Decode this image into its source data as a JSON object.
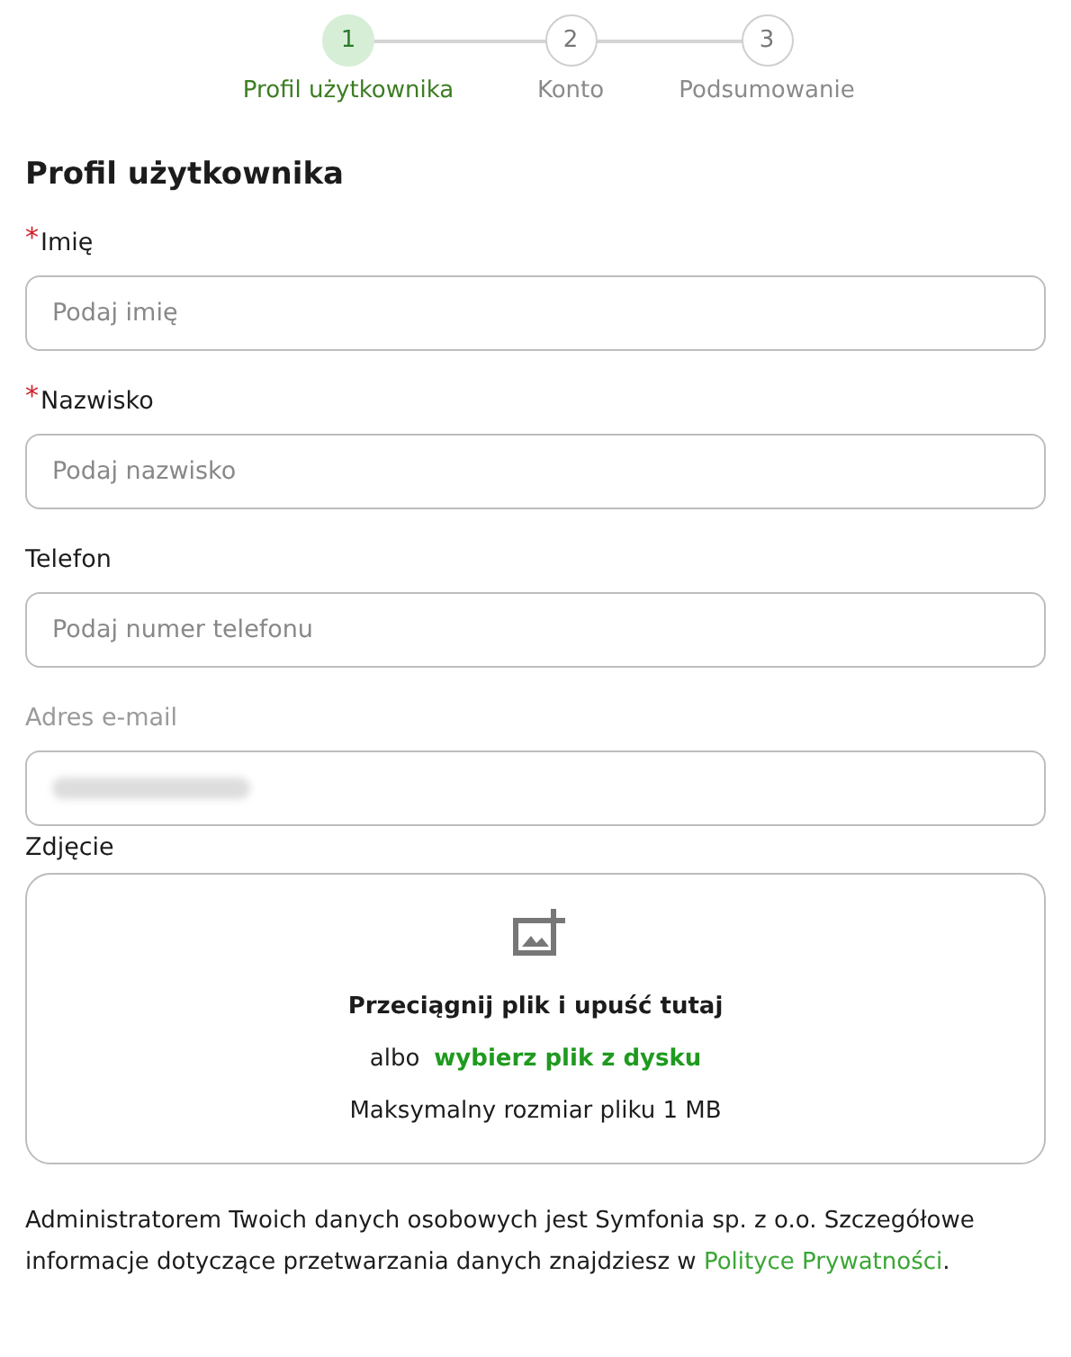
{
  "steps": [
    {
      "number": "1",
      "label": "Profil użytkownika",
      "selected": true
    },
    {
      "number": "2",
      "label": "Konto",
      "selected": false
    },
    {
      "number": "3",
      "label": "Podsumowanie",
      "selected": false
    }
  ],
  "heading": "Profil użytkownika",
  "fields": [
    {
      "required_mark": "*",
      "label": "Imię",
      "disabled": false,
      "placeholder": "Podaj imię"
    },
    {
      "required_mark": "*",
      "label": "Nazwisko",
      "disabled": false,
      "placeholder": "Podaj nazwisko"
    },
    {
      "label": "Telefon",
      "disabled": false,
      "placeholder": "Podaj numer telefonu"
    },
    {
      "label": "Adres e-mail",
      "disabled": true,
      "blurred": true
    }
  ],
  "upload": {
    "label": "Zdjęcie",
    "title": "Przeciągnij plik i upuść tutaj",
    "or": "albo",
    "link": "wybierz plik z dysku",
    "limit": "Maksymalny rozmiar pliku 1 MB"
  },
  "notice": {
    "text": "Administratorem Twoich danych osobowych jest Symfonia sp. z o.o. Szczegółowe informacje dotyczące przetwarzania danych znajdziesz w",
    "link": "Polityce Prywatności",
    "end": "."
  }
}
